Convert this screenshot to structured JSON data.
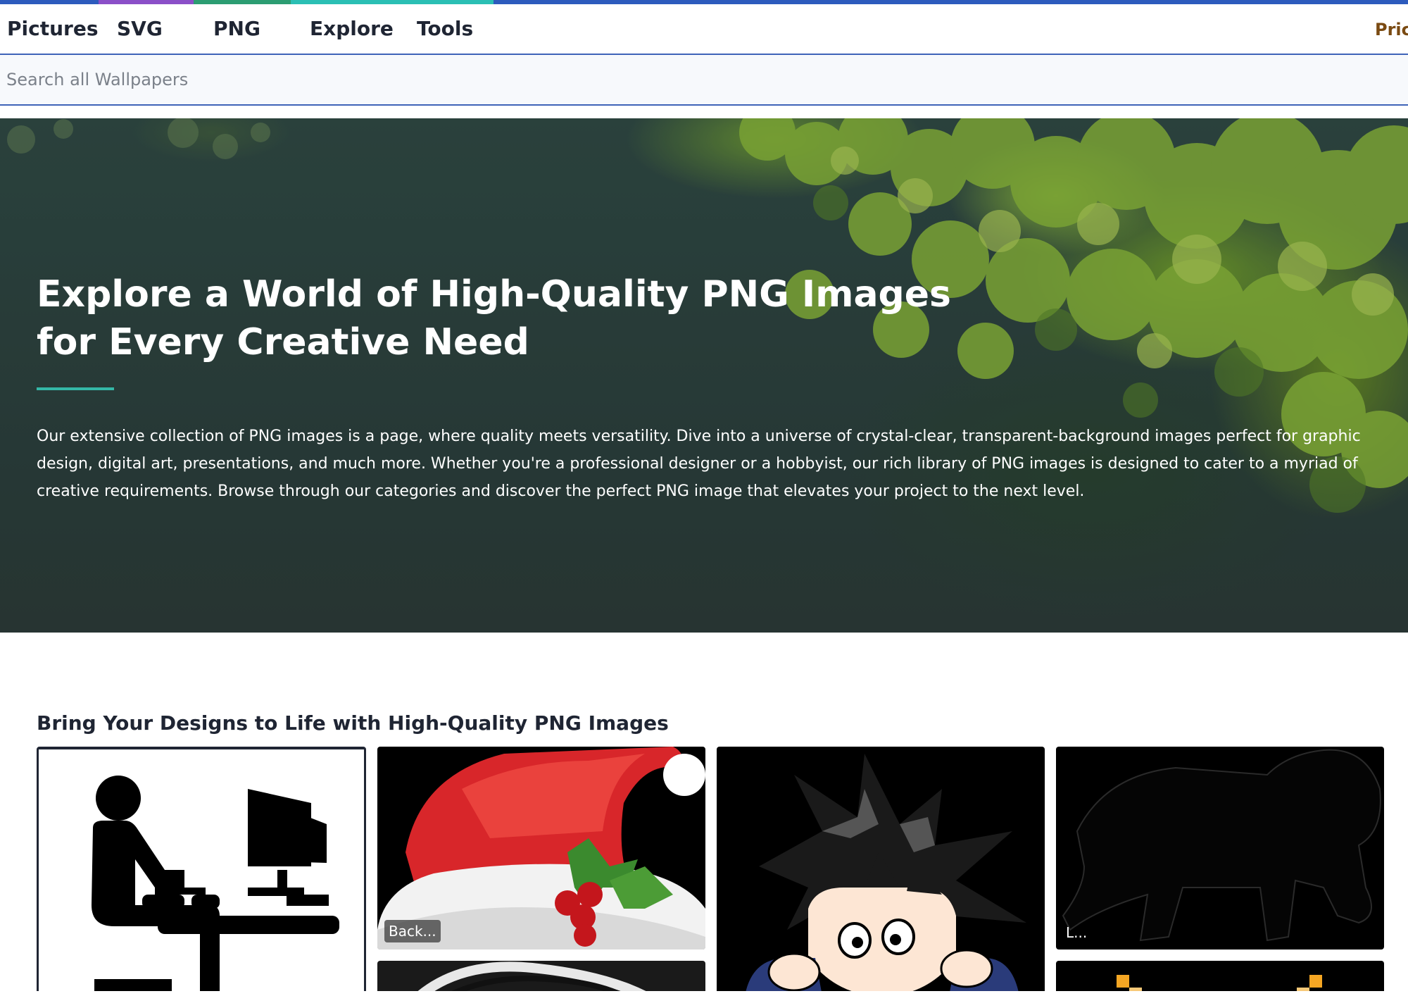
{
  "colors": {
    "topbar": [
      "#2d5bbd",
      "#8b4fc8",
      "#2c9d72",
      "#2bbfb4",
      "#2d5bbd"
    ],
    "accent": "#34b7a7",
    "nav_border": "#3e63b8"
  },
  "nav": {
    "items": [
      {
        "label": "Pictures"
      },
      {
        "label": "SVG"
      },
      {
        "label": "PNG"
      },
      {
        "label": "Explore"
      },
      {
        "label": "Tools"
      }
    ],
    "pricing_label": "Prici"
  },
  "search": {
    "placeholder": "Search all Wallpapers"
  },
  "hero": {
    "title": "Explore a World of High-Quality PNG Images for Every Creative Need",
    "description": "Our extensive collection of PNG images is a page, where quality meets versatility. Dive into a universe of crystal-clear, transparent-background images perfect for graphic design, digital art, presentations, and much more. Whether you're a professional designer or a hobbyist, our rich library of PNG images is designed to cater to a myriad of creative requirements. Browse through our categories and discover the perfect PNG image that elevates your project to the next level."
  },
  "gallery": {
    "title": "Bring Your Designs to Life with High-Quality PNG Images",
    "cards": [
      {
        "icon": "person-at-computer-icon",
        "label": ""
      },
      {
        "icon": "santa-hat-icon",
        "label": "Back..."
      },
      {
        "icon": "anime-boy-icon",
        "label": ""
      },
      {
        "icon": "lion-silhouette-icon",
        "label": "L..."
      }
    ]
  }
}
